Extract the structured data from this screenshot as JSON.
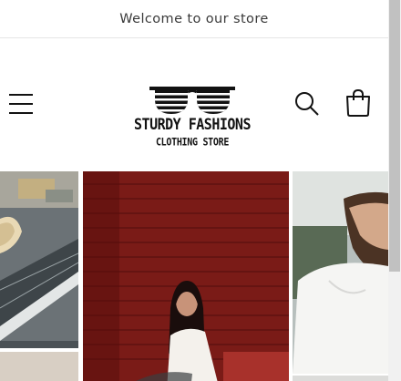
{
  "announcement": {
    "text": "Welcome to our store"
  },
  "header": {
    "logo_title": "STURDY FASHIONS",
    "logo_subtitle": "CLOTHING STORE",
    "icons": [
      "menu-icon",
      "sunglasses-logo-icon",
      "search-icon",
      "cart-icon"
    ]
  },
  "gallery": {
    "slides": [
      "rooftop-photo",
      "model-red-brick-wall-photo",
      "model-white-shirt-photo"
    ]
  },
  "colors": {
    "text": "#121212",
    "announcement_text": "#3a3a3a",
    "brick_red": "#7d1d19",
    "border": "#e6e6e6"
  }
}
